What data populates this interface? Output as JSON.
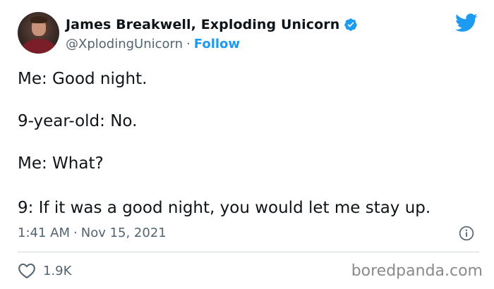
{
  "author": {
    "display_name": "James Breakwell, Exploding Unicorn",
    "handle": "@XplodingUnicorn",
    "separator": "·",
    "follow_label": "Follow"
  },
  "tweet": {
    "lines": [
      "Me: Good night.",
      "9-year-old: No.",
      "Me: What?",
      "9: If it was a good night, you would let me stay up."
    ],
    "time": "1:41 AM",
    "separator": "·",
    "date": "Nov 15, 2021",
    "like_count": "1.9K"
  },
  "watermark": "boredpanda.com",
  "icons": {
    "verified": "verified-badge-icon",
    "brand": "twitter-bird-icon",
    "info": "info-icon",
    "like": "heart-icon"
  },
  "colors": {
    "accent": "#1d9bf0",
    "text": "#0f1419",
    "secondary": "#536471",
    "divider": "#cfd9de"
  }
}
